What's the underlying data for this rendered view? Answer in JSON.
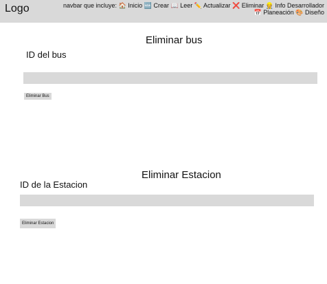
{
  "navbar": {
    "logo": "Logo",
    "prefix": "navbar que incluye:",
    "items": [
      "🏠 Inicio",
      "🆕 Crear",
      "📖 Leer",
      "✏️ Actualizar",
      "❌ Eliminar",
      "👷 Info Desarrollador",
      "📅 Planeación",
      "🎨 Diseño"
    ]
  },
  "bus_section": {
    "title": "Eliminar bus",
    "field_label": "ID del bus",
    "input_value": "",
    "button_label": "Eliminar Bus"
  },
  "station_section": {
    "title": "Eliminar Estacion",
    "field_label": "ID de la Estacion",
    "input_value": "",
    "button_label": "Eliminar Estacion"
  }
}
